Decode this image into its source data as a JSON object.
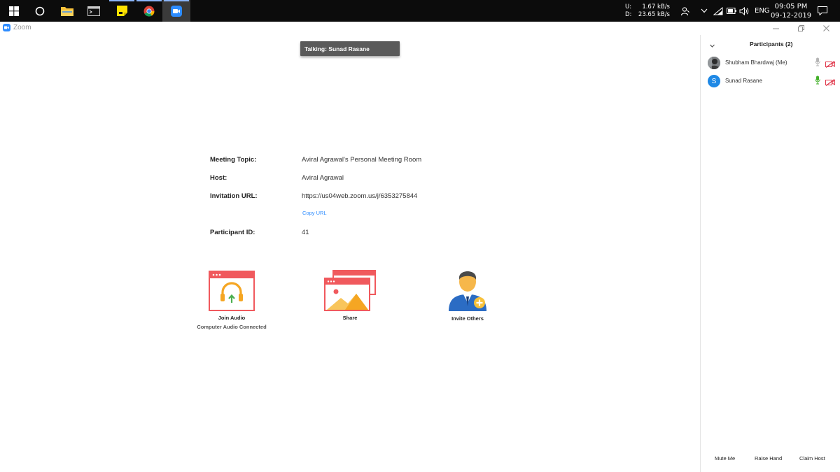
{
  "taskbar": {
    "apps": [
      {
        "name": "start",
        "state": "normal"
      },
      {
        "name": "cortana",
        "state": "normal"
      },
      {
        "name": "file-explorer",
        "state": "normal"
      },
      {
        "name": "terminal",
        "state": "normal"
      },
      {
        "name": "sticky-notes",
        "state": "open"
      },
      {
        "name": "chrome",
        "state": "open"
      },
      {
        "name": "zoom",
        "state": "active"
      }
    ],
    "network": {
      "up_label": "U:",
      "up_value": "1.67 kB/s",
      "down_label": "D:",
      "down_value": "23.65 kB/s"
    },
    "language": "ENG",
    "time": "09:05 PM",
    "date": "09-12-2019"
  },
  "window": {
    "app_name": "Zoom"
  },
  "talking_indicator": "Talking: Sunad Rasane",
  "meeting": {
    "topic_label": "Meeting Topic:",
    "topic": "Aviral Agrawal's Personal Meeting Room",
    "host_label": "Host:",
    "host": "Aviral Agrawal",
    "url_label": "Invitation URL:",
    "url": "https://us04web.zoom.us/j/6353275844",
    "copy_url": "Copy URL",
    "participant_id_label": "Participant ID:",
    "participant_id": "41"
  },
  "actions": {
    "join_audio": "Join Audio",
    "join_audio_sub": "Computer Audio Connected",
    "share": "Share",
    "invite": "Invite Others"
  },
  "participants": {
    "title": "Participants (2)",
    "list": [
      {
        "name": "Shubham Bhardwaj (Me)",
        "avatar": "photo",
        "mic": "muted-gray",
        "video": "off"
      },
      {
        "name": "Sunad Rasane",
        "avatar_letter": "S",
        "avatar_color": "#1e88e5",
        "mic": "active-green",
        "video": "off"
      }
    ],
    "buttons": {
      "mute_me": "Mute Me",
      "raise_hand": "Raise Hand",
      "claim_host": "Claim Host"
    }
  },
  "colors": {
    "accent": "#2d8cff",
    "tile_red": "#f0595d",
    "headset_orange": "#f5a623",
    "arrow_green": "#4caf50",
    "mic_green": "#43b02a",
    "cam_off_red": "#e0364a"
  }
}
